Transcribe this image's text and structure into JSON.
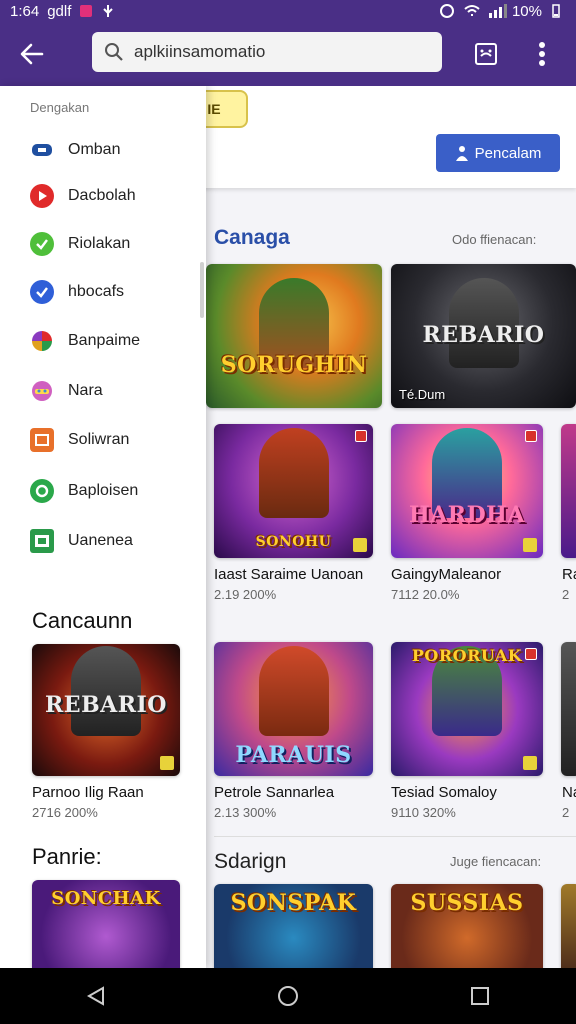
{
  "status_bar": {
    "time": "1:64",
    "carrier": "gdlf",
    "battery": "10%"
  },
  "header": {
    "search_value": "aplkiinsamomatio"
  },
  "chip": {
    "label": "IE"
  },
  "primary_button": {
    "label": "Pencalam"
  },
  "sections": [
    {
      "title": "Canaga",
      "link": "Odo ffienacan:"
    },
    {
      "title": "Sdarign",
      "link": "Juge fiencacan:"
    }
  ],
  "games_row1": [
    {
      "logo": "SORUGHIN",
      "caption": ""
    },
    {
      "logo": "REBARIO",
      "caption": "Té.Dum"
    }
  ],
  "games_row2": [
    {
      "logo": "SONOHU",
      "title": "Iaast Saraime Uanoan",
      "meta": "2.19 200%"
    },
    {
      "logo": "HARDHA",
      "title": "GaingyMaleanor",
      "meta": "7112 20.0%"
    },
    {
      "logo": "",
      "title": "Ra",
      "meta": "2"
    }
  ],
  "games_row3": [
    {
      "logo": "PARAUIS",
      "title": "Petrole Sannarlea",
      "meta": "2.13 300%"
    },
    {
      "logo": "PORORUAK",
      "title": "Tesiad Somaloy",
      "meta": "9110 320%"
    },
    {
      "logo": "",
      "title": "Na",
      "meta": "2"
    }
  ],
  "games_row4": [
    {
      "logo": "SONSPAK"
    },
    {
      "logo": "SUSSIAS"
    }
  ],
  "drawer": {
    "header": "Dengakan",
    "items": [
      {
        "label": "Omban",
        "color": "#1f4fa0"
      },
      {
        "label": "Dacbolah",
        "color": "#e02a2a"
      },
      {
        "label": "Riolakan",
        "color": "#4fbf3a"
      },
      {
        "label": "hbocafs",
        "color": "#2f5fd8"
      },
      {
        "label": "Banpaime",
        "color": "#e0a020"
      },
      {
        "label": "Nara",
        "color": "#d060c0"
      },
      {
        "label": "Soliwran",
        "color": "#e8702a"
      },
      {
        "label": "Baploisen",
        "color": "#2aa84a"
      },
      {
        "label": "Uanenea",
        "color": "#2a9a4a"
      }
    ],
    "section1": "Cancaunn",
    "game": {
      "logo": "REBARIO",
      "title": "Parnoo Ilig Raan",
      "meta": "2716 200%"
    },
    "section2": "Panrie:",
    "game2": {
      "logo": "SONCHAK"
    }
  },
  "colors": {
    "header": "#4a2f86",
    "accent": "#3a5fc8",
    "section_title": "#2a4fa8"
  }
}
